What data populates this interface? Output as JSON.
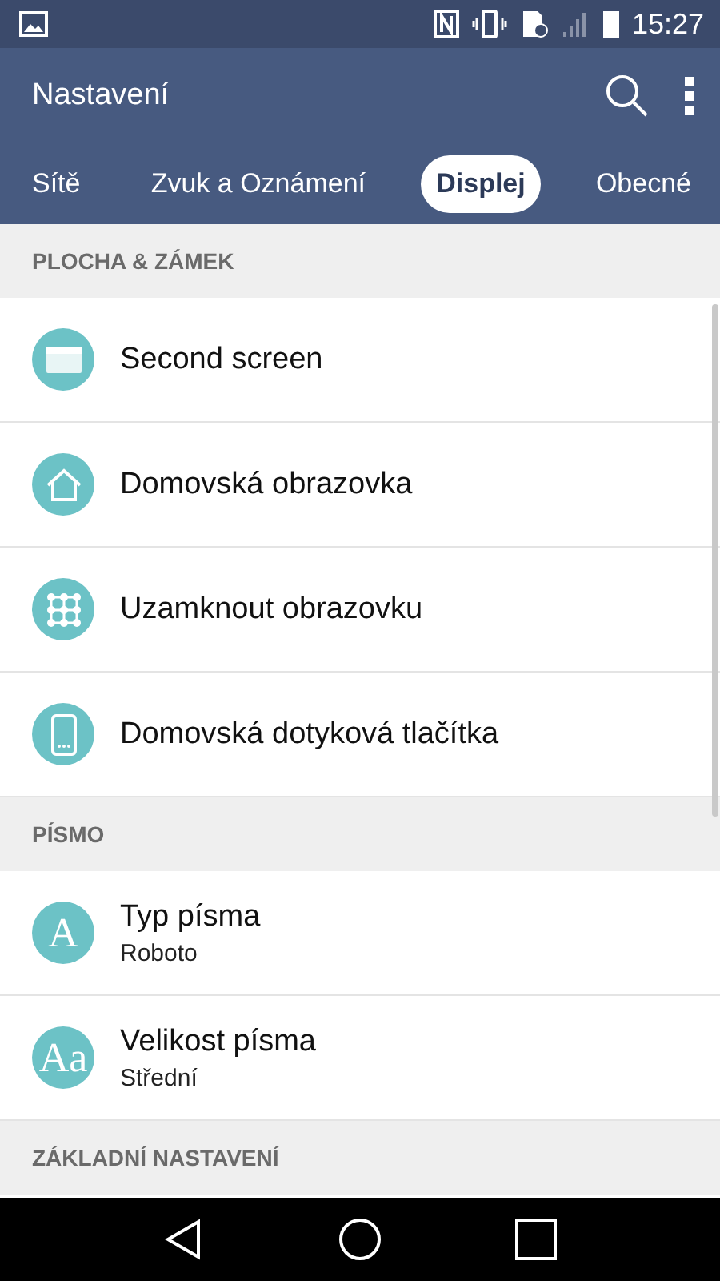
{
  "status_bar": {
    "time": "15:27"
  },
  "app_bar": {
    "title": "Nastavení"
  },
  "tabs": [
    {
      "label": "Sítě",
      "selected": false
    },
    {
      "label": "Zvuk a Oznámení",
      "selected": false
    },
    {
      "label": "Displej",
      "selected": true
    },
    {
      "label": "Obecné",
      "selected": false
    }
  ],
  "sections": [
    {
      "title": "PLOCHA & ZÁMEK",
      "items": [
        {
          "kind": "screen",
          "title": "Second screen"
        },
        {
          "kind": "home",
          "title": "Domovská obrazovka"
        },
        {
          "kind": "pattern",
          "title": "Uzamknout obrazovku"
        },
        {
          "kind": "phone",
          "title": "Domovská dotyková tlačítka"
        }
      ]
    },
    {
      "title": "PÍSMO",
      "items": [
        {
          "kind": "glyph",
          "glyph": "A",
          "title": "Typ písma",
          "subtitle": "Roboto"
        },
        {
          "kind": "glyph",
          "glyph": "Aa",
          "title": "Velikost písma",
          "subtitle": "Střední"
        }
      ]
    },
    {
      "title": "ZÁKLADNÍ NASTAVENÍ"
    }
  ]
}
